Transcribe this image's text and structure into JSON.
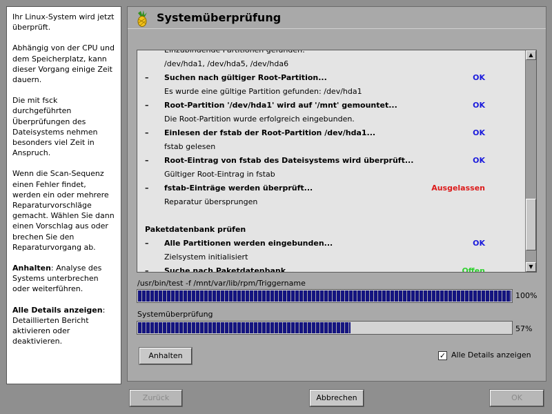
{
  "help": {
    "p1": "Ihr Linux-System wird jetzt überprüft.",
    "p2": "Abhängig von der CPU und dem Speicherplatz, kann dieser Vorgang einige Zeit dauern.",
    "p3": "Die mit fsck durchgeführten Überprüfungen des Dateisystems nehmen besonders viel Zeit in Anspruch.",
    "p4": "Wenn die Scan-Sequenz einen Fehler findet, werden ein oder mehrere Reparaturvorschläge gemacht. Wählen Sie dann einen Vorschlag aus oder brechen Sie den Reparaturvorgang ab.",
    "p5_term": "Anhalten",
    "p5_text": ": Analyse des Systems unterbrechen oder weiterführen.",
    "p6_term": "Alle Details anzeigen",
    "p6_text": ": Detaillierten Bericht aktivieren oder deaktivieren."
  },
  "title": "Systemüberprüfung",
  "log": {
    "rows": [
      {
        "kind": "info",
        "text": "Einzubindende Partitionen gefunden:"
      },
      {
        "kind": "info",
        "text": "/dev/hda1, /dev/hda5, /dev/hda6"
      },
      {
        "kind": "step",
        "text": "Suchen nach gültiger Root-Partition...",
        "status": "OK",
        "status_color": "#1a1adc"
      },
      {
        "kind": "info",
        "text": "Es wurde eine gültige Partition gefunden: /dev/hda1"
      },
      {
        "kind": "step",
        "text": "Root-Partition '/dev/hda1' wird auf '/mnt' gemountet...",
        "status": "OK",
        "status_color": "#1a1adc"
      },
      {
        "kind": "info",
        "text": "Die Root-Partition wurde erfolgreich eingebunden."
      },
      {
        "kind": "step",
        "text": "Einlesen der fstab der Root-Partition /dev/hda1...",
        "status": "OK",
        "status_color": "#1a1adc"
      },
      {
        "kind": "info",
        "text": "fstab gelesen"
      },
      {
        "kind": "step",
        "text": "Root-Eintrag von fstab des Dateisystems wird überprüft...",
        "status": "OK",
        "status_color": "#1a1adc"
      },
      {
        "kind": "info",
        "text": "Gültiger Root-Eintrag in fstab"
      },
      {
        "kind": "step",
        "text": "fstab-Einträge werden überprüft...",
        "status": "Ausgelassen",
        "status_color": "#dc1a1a"
      },
      {
        "kind": "info",
        "text": "Reparatur übersprungen"
      },
      {
        "kind": "blank",
        "text": ""
      },
      {
        "kind": "section",
        "text": "Paketdatenbank prüfen"
      },
      {
        "kind": "step",
        "text": "Alle Partitionen werden eingebunden...",
        "status": "OK",
        "status_color": "#1a1adc"
      },
      {
        "kind": "info",
        "text": "Zielsystem initialisiert"
      },
      {
        "kind": "step",
        "text": "Suche nach Paketdatenbank...",
        "status": "Offen",
        "status_color": "#2ed12e"
      }
    ]
  },
  "progress1": {
    "label": "/usr/bin/test -f /mnt/var/lib/rpm/Triggername",
    "percent_text": "100%",
    "fraction": 1.0
  },
  "progress2": {
    "label": "Systemüberprüfung",
    "percent_text": "57%",
    "fraction": 0.57
  },
  "buttons": {
    "pause": "Anhalten",
    "back": "Zurück",
    "abort": "Abbrechen",
    "ok": "OK"
  },
  "details_checkbox": {
    "label": "Alle Details anzeigen",
    "checked": true
  }
}
